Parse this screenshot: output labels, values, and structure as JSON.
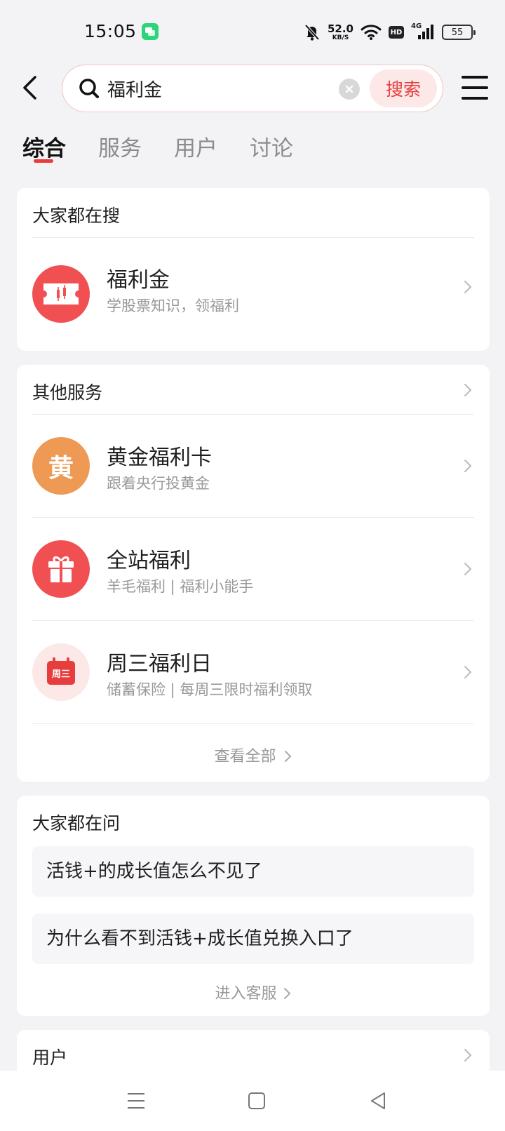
{
  "status_bar": {
    "time": "15:05",
    "net_speed": "52.0",
    "net_unit": "KB/S",
    "hd_label": "HD",
    "network_type": "4G",
    "battery": "55"
  },
  "search": {
    "query": "福利金",
    "button_label": "搜索"
  },
  "tabs": [
    {
      "label": "综合",
      "active": true
    },
    {
      "label": "服务",
      "active": false
    },
    {
      "label": "用户",
      "active": false
    },
    {
      "label": "讨论",
      "active": false
    }
  ],
  "trending": {
    "title": "大家都在搜",
    "item": {
      "title": "福利金",
      "subtitle": "学股票知识，领福利",
      "icon": "ticket-icon"
    }
  },
  "other_services": {
    "title": "其他服务",
    "items": [
      {
        "title": "黄金福利卡",
        "subtitle": "跟着央行投黄金",
        "icon_text": "黄",
        "icon_color": "#ee9a55"
      },
      {
        "title": "全站福利",
        "subtitle": "羊毛福利 | 福利小能手",
        "icon": "gift-icon",
        "icon_color": "#f05052"
      },
      {
        "title": "周三福利日",
        "subtitle": "储蓄保险 | 每周三限时福利领取",
        "icon_text": "周三",
        "icon_color": "#fde8e8"
      }
    ],
    "view_all": "查看全部"
  },
  "faq": {
    "title": "大家都在问",
    "questions": [
      "活钱+的成长值怎么不见了",
      "为什么看不到活钱+成长值兑换入口了"
    ],
    "service_link": "进入客服"
  },
  "users": {
    "title": "用户"
  },
  "colors": {
    "accent": "#e83d3d",
    "background": "#f3f3f6"
  }
}
